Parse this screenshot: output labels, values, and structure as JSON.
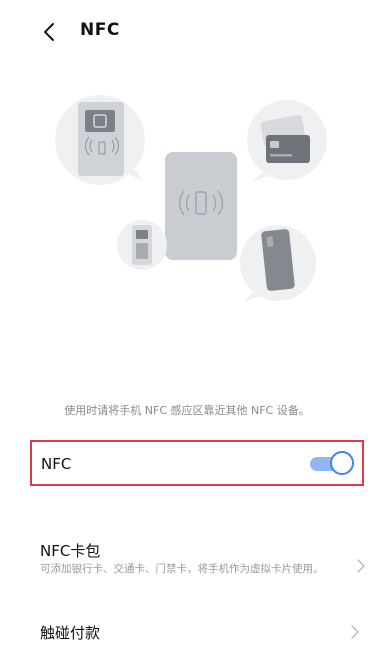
{
  "header": {
    "title": "NFC",
    "back_icon": "chevron-left-icon"
  },
  "illustration": {
    "icons": [
      "door-access-icon",
      "bank-card-icon",
      "nfc-phone-icon",
      "pos-terminal-icon",
      "phone-icon"
    ]
  },
  "hint": "使用时请将手机 NFC 感应区靠近其他 NFC 设备。",
  "nfc_setting": {
    "label": "NFC",
    "enabled": true
  },
  "wallet": {
    "title": "NFC卡包",
    "description": "可添加银行卡、交通卡、门禁卡，将手机作为虚拟卡片使用。"
  },
  "tap_pay": {
    "title": "触碰付款"
  },
  "colors": {
    "accent": "#3f82f0",
    "highlight_border": "#e03a4a",
    "secondary_text": "#9a9a9a"
  }
}
